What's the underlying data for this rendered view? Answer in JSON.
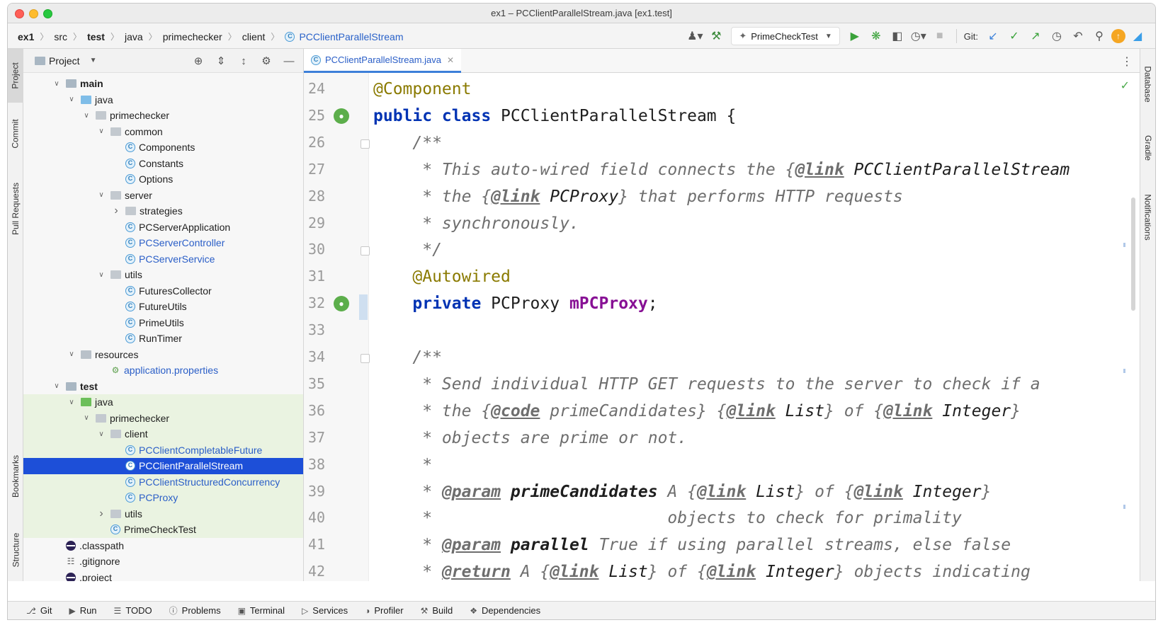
{
  "window": {
    "title": "ex1 – PCClientParallelStream.java [ex1.test]"
  },
  "breadcrumbs": [
    "ex1",
    "src",
    "test",
    "java",
    "primechecker",
    "client",
    "PCClientParallelStream"
  ],
  "toolbar": {
    "run_config": "PrimeCheckTest",
    "git_label": "Git:"
  },
  "left_tool_tabs": [
    "Project",
    "Commit",
    "Pull Requests",
    "Bookmarks",
    "Structure"
  ],
  "right_tool_tabs": [
    "Database",
    "Gradle",
    "Notifications"
  ],
  "project_panel": {
    "title": "Project",
    "tree": [
      {
        "label": "main",
        "depth": 2,
        "arrow": "down",
        "icon": "module-folder",
        "bold": true
      },
      {
        "label": "java",
        "depth": 3,
        "arrow": "down",
        "icon": "source-folder"
      },
      {
        "label": "primechecker",
        "depth": 4,
        "arrow": "down",
        "icon": "package"
      },
      {
        "label": "common",
        "depth": 5,
        "arrow": "down",
        "icon": "package"
      },
      {
        "label": "Components",
        "depth": 6,
        "icon": "class"
      },
      {
        "label": "Constants",
        "depth": 6,
        "icon": "class"
      },
      {
        "label": "Options",
        "depth": 6,
        "icon": "class"
      },
      {
        "label": "server",
        "depth": 5,
        "arrow": "down",
        "icon": "package"
      },
      {
        "label": "strategies",
        "depth": 6,
        "arrow": "right",
        "icon": "package"
      },
      {
        "label": "PCServerApplication",
        "depth": 6,
        "icon": "class"
      },
      {
        "label": "PCServerController",
        "depth": 6,
        "icon": "class",
        "blue": true
      },
      {
        "label": "PCServerService",
        "depth": 6,
        "icon": "class",
        "blue": true
      },
      {
        "label": "utils",
        "depth": 5,
        "arrow": "down",
        "icon": "package"
      },
      {
        "label": "FuturesCollector",
        "depth": 6,
        "icon": "class"
      },
      {
        "label": "FutureUtils",
        "depth": 6,
        "icon": "class"
      },
      {
        "label": "PrimeUtils",
        "depth": 6,
        "icon": "class"
      },
      {
        "label": "RunTimer",
        "depth": 6,
        "icon": "class"
      },
      {
        "label": "resources",
        "depth": 3,
        "arrow": "down",
        "icon": "resources-folder"
      },
      {
        "label": "application.properties",
        "depth": 5,
        "icon": "properties",
        "blue": true
      },
      {
        "label": "test",
        "depth": 2,
        "arrow": "down",
        "icon": "module-folder",
        "bold": true
      },
      {
        "label": "java",
        "depth": 3,
        "arrow": "down",
        "icon": "test-folder",
        "hl": true
      },
      {
        "label": "primechecker",
        "depth": 4,
        "arrow": "down",
        "icon": "package",
        "hl": true
      },
      {
        "label": "client",
        "depth": 5,
        "arrow": "down",
        "icon": "package",
        "hl": true
      },
      {
        "label": "PCClientCompletableFuture",
        "depth": 6,
        "icon": "class",
        "blue": true,
        "hl": true
      },
      {
        "label": "PCClientParallelStream",
        "depth": 6,
        "icon": "class",
        "selected": true
      },
      {
        "label": "PCClientStructuredConcurrency",
        "depth": 6,
        "icon": "class",
        "blue": true,
        "hl": true
      },
      {
        "label": "PCProxy",
        "depth": 6,
        "icon": "class",
        "blue": true,
        "hl": true
      },
      {
        "label": "utils",
        "depth": 5,
        "arrow": "right",
        "icon": "package",
        "hl": true
      },
      {
        "label": "PrimeCheckTest",
        "depth": 5,
        "icon": "class",
        "hl": true
      },
      {
        "label": ".classpath",
        "depth": 2,
        "icon": "eclipse"
      },
      {
        "label": ".gitignore",
        "depth": 2,
        "icon": "file"
      },
      {
        "label": ".project",
        "depth": 2,
        "icon": "eclipse"
      }
    ]
  },
  "editor": {
    "tab_label": "PCClientParallelStream.java",
    "line_numbers": [
      "24",
      "25",
      "26",
      "27",
      "28",
      "29",
      "30",
      "31",
      "32",
      "33",
      "34",
      "35",
      "36",
      "37",
      "38",
      "39",
      "40",
      "41",
      "42"
    ],
    "lines": [
      [
        {
          "t": "@Component",
          "c": "ann"
        }
      ],
      [
        {
          "t": "public class ",
          "c": "kw"
        },
        {
          "t": "PCClientParallelStream {",
          "c": ""
        }
      ],
      [
        {
          "t": "    /**",
          "c": "cmt"
        }
      ],
      [
        {
          "t": "     * This auto-wired field connects the {",
          "c": "cmt"
        },
        {
          "t": "@link",
          "c": "tag"
        },
        {
          "t": " PCClientParallelStream",
          "c": "tref"
        }
      ],
      [
        {
          "t": "     * the {",
          "c": "cmt"
        },
        {
          "t": "@link",
          "c": "tag"
        },
        {
          "t": " PCProxy",
          "c": "tref"
        },
        {
          "t": "} that performs HTTP requests",
          "c": "cmt"
        }
      ],
      [
        {
          "t": "     * synchronously.",
          "c": "cmt"
        }
      ],
      [
        {
          "t": "     */",
          "c": "cmt"
        }
      ],
      [
        {
          "t": "    @Autowired",
          "c": "ann"
        }
      ],
      [
        {
          "t": "    private ",
          "c": "kw"
        },
        {
          "t": "PCProxy ",
          "c": ""
        },
        {
          "t": "mPCProxy",
          "c": "field"
        },
        {
          "t": ";",
          "c": ""
        }
      ],
      [
        {
          "t": "",
          "c": ""
        }
      ],
      [
        {
          "t": "    /**",
          "c": "cmt"
        }
      ],
      [
        {
          "t": "     * Send individual HTTP GET requests to the server to check if a",
          "c": "cmt"
        }
      ],
      [
        {
          "t": "     * the {",
          "c": "cmt"
        },
        {
          "t": "@code",
          "c": "tag"
        },
        {
          "t": " primeCandidates} {",
          "c": "cmt"
        },
        {
          "t": "@link",
          "c": "tag"
        },
        {
          "t": " List",
          "c": "tref"
        },
        {
          "t": "} of {",
          "c": "cmt"
        },
        {
          "t": "@link",
          "c": "tag"
        },
        {
          "t": " Integer",
          "c": "tref"
        },
        {
          "t": "}",
          "c": "cmt"
        }
      ],
      [
        {
          "t": "     * objects are prime or not.",
          "c": "cmt"
        }
      ],
      [
        {
          "t": "     *",
          "c": "cmt"
        }
      ],
      [
        {
          "t": "     * ",
          "c": "cmt"
        },
        {
          "t": "@param",
          "c": "tag"
        },
        {
          "t": " primeCandidates",
          "c": "pname"
        },
        {
          "t": " A {",
          "c": "cmt"
        },
        {
          "t": "@link",
          "c": "tag"
        },
        {
          "t": " List",
          "c": "tref"
        },
        {
          "t": "} of {",
          "c": "cmt"
        },
        {
          "t": "@link",
          "c": "tag"
        },
        {
          "t": " Integer",
          "c": "tref"
        },
        {
          "t": "}",
          "c": "cmt"
        }
      ],
      [
        {
          "t": "     *                        objects to check for primality",
          "c": "cmt"
        }
      ],
      [
        {
          "t": "     * ",
          "c": "cmt"
        },
        {
          "t": "@param",
          "c": "tag"
        },
        {
          "t": " parallel",
          "c": "pname"
        },
        {
          "t": " True if using parallel streams, else false",
          "c": "cmt"
        }
      ],
      [
        {
          "t": "     * ",
          "c": "cmt"
        },
        {
          "t": "@return",
          "c": "tag"
        },
        {
          "t": " A {",
          "c": "cmt"
        },
        {
          "t": "@link",
          "c": "tag"
        },
        {
          "t": " List",
          "c": "tref"
        },
        {
          "t": "} of {",
          "c": "cmt"
        },
        {
          "t": "@link",
          "c": "tag"
        },
        {
          "t": " Integer",
          "c": "tref"
        },
        {
          "t": "} objects indicating",
          "c": "cmt"
        }
      ]
    ]
  },
  "statusbar": [
    {
      "label": "Git",
      "icon": "git-branch-icon"
    },
    {
      "label": "Run",
      "icon": "run-icon"
    },
    {
      "label": "TODO",
      "icon": "todo-icon"
    },
    {
      "label": "Problems",
      "icon": "problems-icon"
    },
    {
      "label": "Terminal",
      "icon": "terminal-icon"
    },
    {
      "label": "Services",
      "icon": "services-icon"
    },
    {
      "label": "Profiler",
      "icon": "profiler-icon"
    },
    {
      "label": "Build",
      "icon": "build-icon"
    },
    {
      "label": "Dependencies",
      "icon": "dependencies-icon"
    }
  ]
}
